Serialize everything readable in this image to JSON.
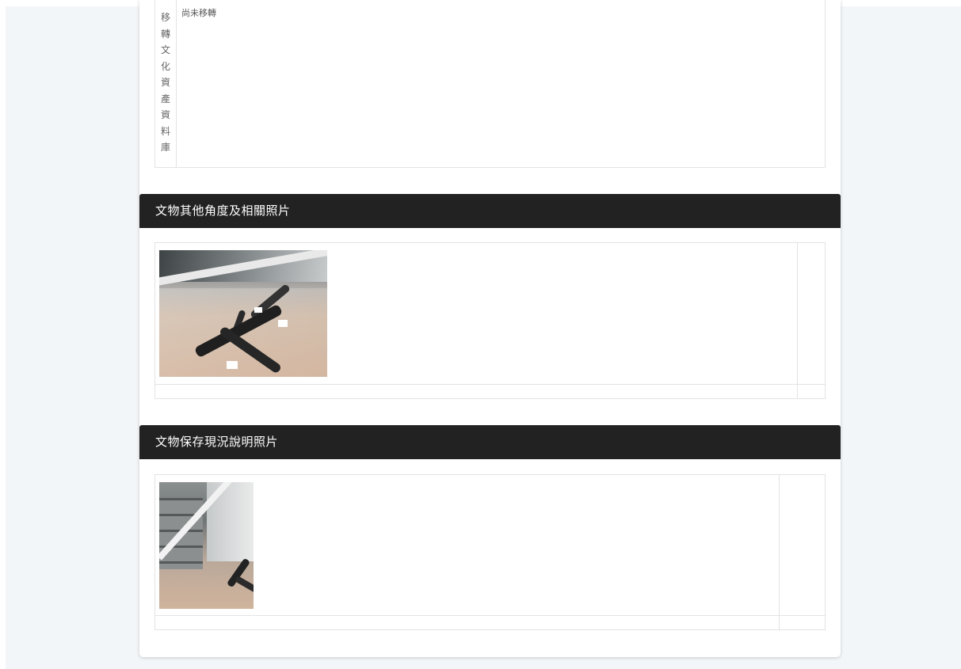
{
  "info": {
    "label_chars": [
      "移",
      "轉",
      "文",
      "化",
      "資",
      "產",
      "資",
      "料",
      "庫"
    ],
    "value": "尚未移轉"
  },
  "sections": {
    "other_angles": {
      "title": "文物其他角度及相關照片"
    },
    "preservation": {
      "title": "文物保存現況說明照片"
    }
  }
}
